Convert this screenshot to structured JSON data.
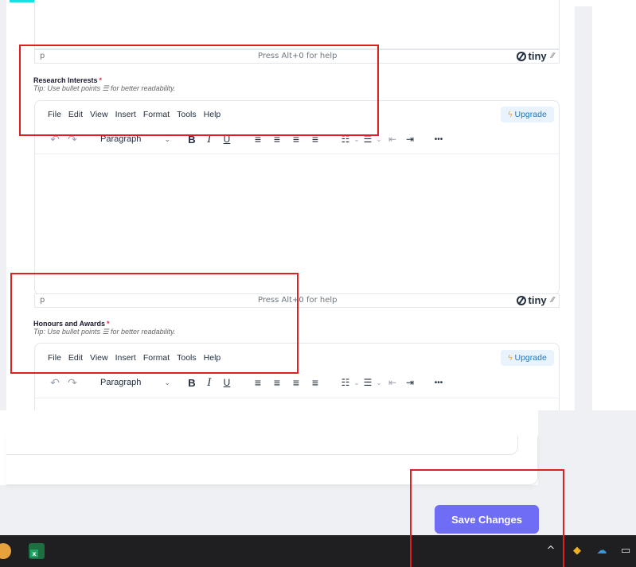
{
  "editors": [
    {
      "status_path": "p",
      "status_help": "Press Alt+0 for help",
      "brand": "tiny",
      "label": "Research Interests",
      "required_mark": "*",
      "tip": "Tip: Use bullet points ☰ for better readability.",
      "menu": [
        "File",
        "Edit",
        "View",
        "Insert",
        "Format",
        "Tools",
        "Help"
      ],
      "upgrade": "Upgrade",
      "block_format": "Paragraph"
    },
    {
      "status_path": "p",
      "status_help": "Press Alt+0 for help",
      "brand": "tiny",
      "label": "Honours and Awards",
      "required_mark": "*",
      "tip": "Tip: Use bullet points ☰ for better readability.",
      "menu": [
        "File",
        "Edit",
        "View",
        "Insert",
        "Format",
        "Tools",
        "Help"
      ],
      "upgrade": "Upgrade",
      "block_format": "Paragraph"
    }
  ],
  "toolbar_icons": {
    "undo": "↶",
    "redo": "↷",
    "bold": "B",
    "italic": "I",
    "underline": "U",
    "align_left": "≡",
    "align_center": "≡",
    "align_right": "≡",
    "justify": "≡",
    "bullet_list": "☷",
    "numbered_list": "☰",
    "outdent": "⇤",
    "indent": "⇥",
    "more": "•••",
    "chevron": "⌄"
  },
  "save_button": "Save Changes",
  "colors": {
    "accent": "#6f6df5",
    "upgrade_bg": "#e8f3fd",
    "upgrade_text": "#207ab7",
    "required": "#dc3545",
    "highlight_box": "#e02020",
    "taskbar": "#1f1f22"
  }
}
